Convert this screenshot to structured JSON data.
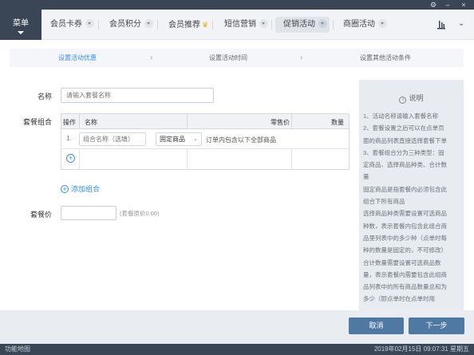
{
  "titlebar": {
    "settings_icon": "gear-icon",
    "minimize": "–",
    "close": "×"
  },
  "menu": {
    "label": "菜单"
  },
  "nav": {
    "tabs": [
      {
        "label": "会员卡券"
      },
      {
        "label": "会员积分"
      },
      {
        "label": "会员推荐"
      },
      {
        "label": "短信营销"
      },
      {
        "label": "促销活动"
      },
      {
        "label": "商圈活动"
      }
    ],
    "crown": "♛",
    "store_icon": "store-icon",
    "chevron": "⌄"
  },
  "steps": {
    "items": [
      "设置活动优惠",
      "设置活动时间",
      "设置其他活动条件"
    ],
    "arrow": "›",
    "active_color": "#3a8ee6"
  },
  "form": {
    "name_label": "名称",
    "name_placeholder": "请输入套餐名称",
    "combo_label": "套餐组合",
    "table_headers": {
      "op": "操作",
      "name": "名称",
      "retail": "零售价",
      "qty": "数量"
    },
    "row1": {
      "num": "1.",
      "name_placeholder": "组合名称（选填）",
      "select_value": "固定商品",
      "note": "订单内包含以下全部商品"
    },
    "plus": "+",
    "add_combo": "添加组合",
    "price_label": "套餐价",
    "price_note": "(套餐原价0.00)"
  },
  "help": {
    "title": "说明",
    "info_icon": "i",
    "lines": [
      "1、活动名称请输入套餐名称",
      "2、套餐设置之后可以在点单页",
      "面的商品列表直接选择套餐下单",
      "3、套餐组合分为三种类型：固",
      "定商品、选择商品种类、合计数",
      "量",
      "固定商品是指套餐内必须包含此",
      "组合下所有商品",
      "选择商品种类需要设置可选商品",
      "种数，表示套餐内包含此组合商",
      "品里列表中的多少种（点单时每",
      "种的数量是固定的，不可修改）",
      "合计数量需要设置可选商品数",
      "量，表示套餐内需要包含此组商",
      "品列表中的所有商品数量总和为",
      "多少（即点单时在点单时用"
    ]
  },
  "buttons": {
    "cancel": "取消",
    "next": "下一步"
  },
  "status": {
    "left": "功能地图",
    "right": "2019年02月15日 09:07:31 星期五"
  }
}
